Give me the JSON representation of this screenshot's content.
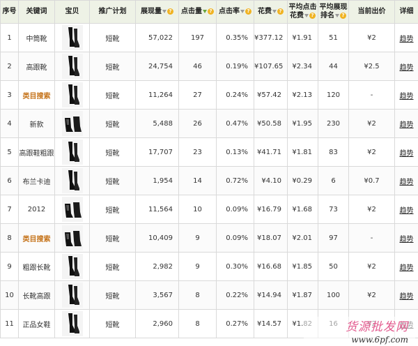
{
  "headers": {
    "seq": "序号",
    "keyword": "关键词",
    "item": "宝贝",
    "plan": "推广计划",
    "impressions": "展现量",
    "clicks": "点击量",
    "ctr": "点击率",
    "cost": "花费",
    "avg_click_cost_l1": "平均点击",
    "avg_click_cost_l2": "花费",
    "avg_rank_l1": "平均展现",
    "avg_rank_l2": "排名",
    "current_bid": "当前出价",
    "detail": "详细"
  },
  "rows": [
    {
      "seq": "1",
      "keyword": "中筒靴",
      "cat": false,
      "thumb": "boot-tall",
      "plan": "短靴",
      "impressions": "57,022",
      "clicks": "197",
      "ctr": "0.35%",
      "cost": "¥377.12",
      "avg_cost": "¥1.91",
      "avg_rank": "51",
      "bid": "¥2",
      "detail": "趋势"
    },
    {
      "seq": "2",
      "keyword": "高跟靴",
      "cat": false,
      "thumb": "boot-tall",
      "plan": "短靴",
      "impressions": "24,754",
      "clicks": "46",
      "ctr": "0.19%",
      "cost": "¥107.65",
      "avg_cost": "¥2.34",
      "avg_rank": "44",
      "bid": "¥2.5",
      "detail": "趋势"
    },
    {
      "seq": "3",
      "keyword": "类目搜索",
      "cat": true,
      "thumb": "boot-tall",
      "plan": "短靴",
      "impressions": "11,264",
      "clicks": "27",
      "ctr": "0.24%",
      "cost": "¥57.42",
      "avg_cost": "¥2.13",
      "avg_rank": "120",
      "bid": "-",
      "detail": "趋势"
    },
    {
      "seq": "4",
      "keyword": "新款",
      "cat": false,
      "thumb": "boot-pair",
      "plan": "短靴",
      "impressions": "5,488",
      "clicks": "26",
      "ctr": "0.47%",
      "cost": "¥50.58",
      "avg_cost": "¥1.95",
      "avg_rank": "230",
      "bid": "¥2",
      "detail": "趋势"
    },
    {
      "seq": "5",
      "keyword": "高跟鞋粗跟",
      "cat": false,
      "thumb": "boot-tall",
      "plan": "短靴",
      "impressions": "17,707",
      "clicks": "23",
      "ctr": "0.13%",
      "cost": "¥41.71",
      "avg_cost": "¥1.81",
      "avg_rank": "83",
      "bid": "¥2",
      "detail": "趋势"
    },
    {
      "seq": "6",
      "keyword": "布兰卡迪",
      "cat": false,
      "thumb": "boot-tall",
      "plan": "短靴",
      "impressions": "1,954",
      "clicks": "14",
      "ctr": "0.72%",
      "cost": "¥4.10",
      "avg_cost": "¥0.29",
      "avg_rank": "6",
      "bid": "¥0.7",
      "detail": "趋势"
    },
    {
      "seq": "7",
      "keyword": "2012",
      "cat": false,
      "thumb": "boot-pair",
      "plan": "短靴",
      "impressions": "11,564",
      "clicks": "10",
      "ctr": "0.09%",
      "cost": "¥16.79",
      "avg_cost": "¥1.68",
      "avg_rank": "73",
      "bid": "¥2",
      "detail": "趋势"
    },
    {
      "seq": "8",
      "keyword": "类目搜索",
      "cat": true,
      "thumb": "boot-pair",
      "plan": "短靴",
      "impressions": "10,409",
      "clicks": "9",
      "ctr": "0.09%",
      "cost": "¥18.07",
      "avg_cost": "¥2.01",
      "avg_rank": "97",
      "bid": "-",
      "detail": "趋势"
    },
    {
      "seq": "9",
      "keyword": "粗跟长靴",
      "cat": false,
      "thumb": "boot-tall",
      "plan": "短靴",
      "impressions": "2,982",
      "clicks": "9",
      "ctr": "0.30%",
      "cost": "¥16.68",
      "avg_cost": "¥1.85",
      "avg_rank": "50",
      "bid": "¥2",
      "detail": "趋势"
    },
    {
      "seq": "10",
      "keyword": "长靴高跟",
      "cat": false,
      "thumb": "boot-tall",
      "plan": "短靴",
      "impressions": "3,567",
      "clicks": "8",
      "ctr": "0.22%",
      "cost": "¥14.94",
      "avg_cost": "¥1.87",
      "avg_rank": "100",
      "bid": "¥2",
      "detail": "趋势"
    },
    {
      "seq": "11",
      "keyword": "正品女鞋",
      "cat": false,
      "thumb": "boot-tall",
      "plan": "短靴",
      "impressions": "2,960",
      "clicks": "8",
      "ctr": "0.27%",
      "cost": "¥14.57",
      "avg_cost": "¥1.82",
      "avg_rank": "16",
      "bid": "¥2",
      "detail": "趋势"
    }
  ],
  "watermark": {
    "text_cn": "货源批发网",
    "url": "www.6pf.com"
  },
  "colors": {
    "header_bg": "#eef2e6",
    "category_text": "#c5731a",
    "sort_active": "#6aa53a",
    "help_icon": "#f0b323",
    "watermark_cn": "#e35b8f"
  }
}
